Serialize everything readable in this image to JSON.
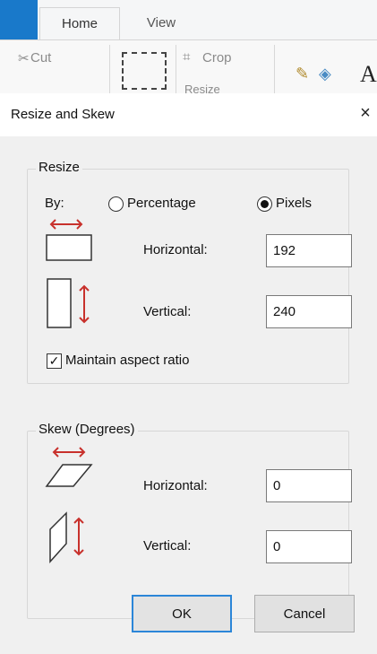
{
  "ribbon": {
    "tabs": [
      {
        "label": "Home"
      },
      {
        "label": "View"
      }
    ],
    "cut_label": "Cut",
    "crop_label": "Crop",
    "resize_label": "Resize",
    "text_tool_label": "A"
  },
  "dialog": {
    "title": "Resize and Skew",
    "close_glyph": "×",
    "resize": {
      "group_label": "Resize",
      "by_label": "By:",
      "percentage_label": "Percentage",
      "pixels_label": "Pixels",
      "selected_unit": "Pixels",
      "horizontal_label": "Horizontal:",
      "horizontal_value": "192",
      "vertical_label": "Vertical:",
      "vertical_value": "240",
      "maintain_label": "Maintain aspect ratio",
      "maintain_checked": true
    },
    "skew": {
      "group_label": "Skew (Degrees)",
      "horizontal_label": "Horizontal:",
      "horizontal_value": "0",
      "vertical_label": "Vertical:",
      "vertical_value": "0"
    },
    "buttons": {
      "ok_label": "OK",
      "cancel_label": "Cancel"
    }
  },
  "colors": {
    "arrow_red": "#c8312c",
    "focus_blue": "#2b86d8",
    "file_tab_blue": "#1979ca"
  }
}
